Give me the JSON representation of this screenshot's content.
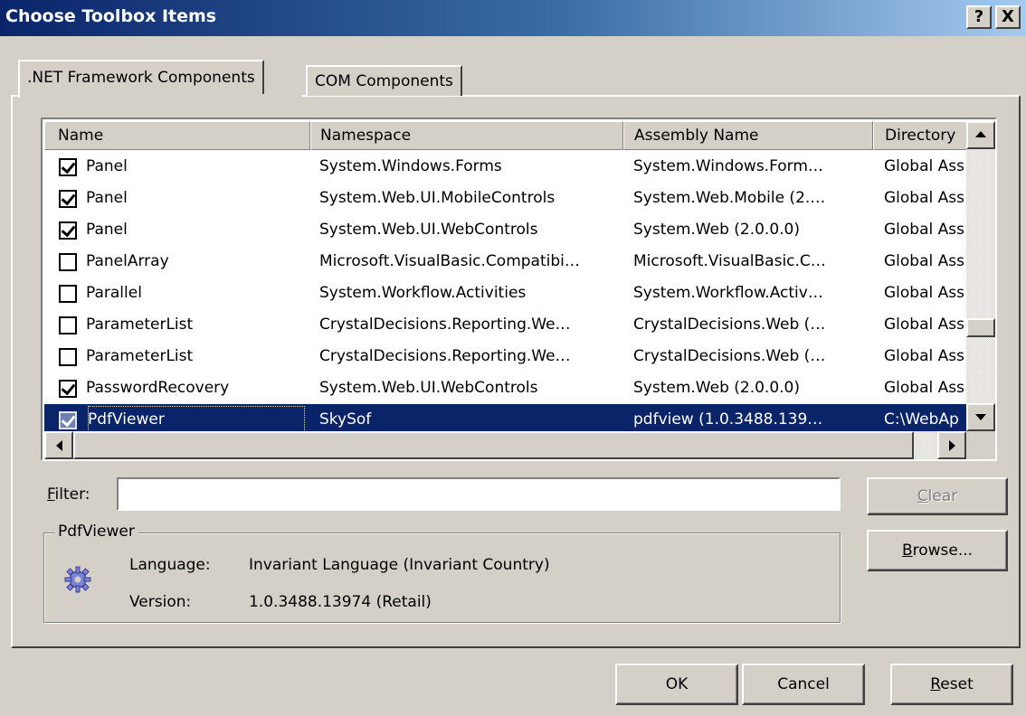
{
  "window": {
    "title": "Choose Toolbox Items",
    "help_glyph": "?",
    "close_glyph": "X"
  },
  "tabs": [
    {
      "label": ".NET Framework Components",
      "active": true
    },
    {
      "label": "COM Components",
      "active": false
    }
  ],
  "list": {
    "columns": [
      "Name",
      "Namespace",
      "Assembly Name",
      "Directory"
    ],
    "rows": [
      {
        "checked": true,
        "name": "Panel",
        "namespace": "System.Windows.Forms",
        "assembly": "System.Windows.Form…",
        "directory": "Global Ass"
      },
      {
        "checked": true,
        "name": "Panel",
        "namespace": "System.Web.UI.MobileControls",
        "assembly": "System.Web.Mobile (2.…",
        "directory": "Global Ass"
      },
      {
        "checked": true,
        "name": "Panel",
        "namespace": "System.Web.UI.WebControls",
        "assembly": "System.Web (2.0.0.0)",
        "directory": "Global Ass"
      },
      {
        "checked": false,
        "name": "PanelArray",
        "namespace": "Microsoft.VisualBasic.Compatibi…",
        "assembly": "Microsoft.VisualBasic.C…",
        "directory": "Global Ass"
      },
      {
        "checked": false,
        "name": "Parallel",
        "namespace": "System.Workflow.Activities",
        "assembly": "System.Workflow.Activ…",
        "directory": "Global Ass"
      },
      {
        "checked": false,
        "name": "ParameterList",
        "namespace": "CrystalDecisions.Reporting.We…",
        "assembly": "CrystalDecisions.Web (…",
        "directory": "Global Ass"
      },
      {
        "checked": false,
        "name": "ParameterList",
        "namespace": "CrystalDecisions.Reporting.We…",
        "assembly": "CrystalDecisions.Web (…",
        "directory": "Global Ass"
      },
      {
        "checked": true,
        "name": "PasswordRecovery",
        "namespace": "System.Web.UI.WebControls",
        "assembly": "System.Web (2.0.0.0)",
        "directory": "Global Ass"
      },
      {
        "checked": true,
        "name": "PdfViewer",
        "namespace": "SkySof",
        "assembly": "pdfview (1.0.3488.139…",
        "directory": "C:\\WebAp",
        "selected": true
      }
    ],
    "vertical_scroll_fraction": 0.72
  },
  "filter": {
    "label_prefix": "",
    "label_hotkey": "F",
    "label_rest": "ilter:",
    "value": "",
    "clear_hotkey": "C",
    "clear_rest": "lear"
  },
  "details": {
    "group_title": "PdfViewer",
    "icon": "gear-icon",
    "language_label": "Language:",
    "language_value": "Invariant Language (Invariant Country)",
    "version_label": "Version:",
    "version_value": "1.0.3488.13974 (Retail)"
  },
  "browse": {
    "hotkey": "B",
    "rest": "rowse..."
  },
  "footer": {
    "ok_label": "OK",
    "cancel_label": "Cancel",
    "reset_hotkey": "R",
    "reset_rest": "eset"
  },
  "colors": {
    "selection": "#0a246a",
    "face": "#d4d0c8"
  }
}
